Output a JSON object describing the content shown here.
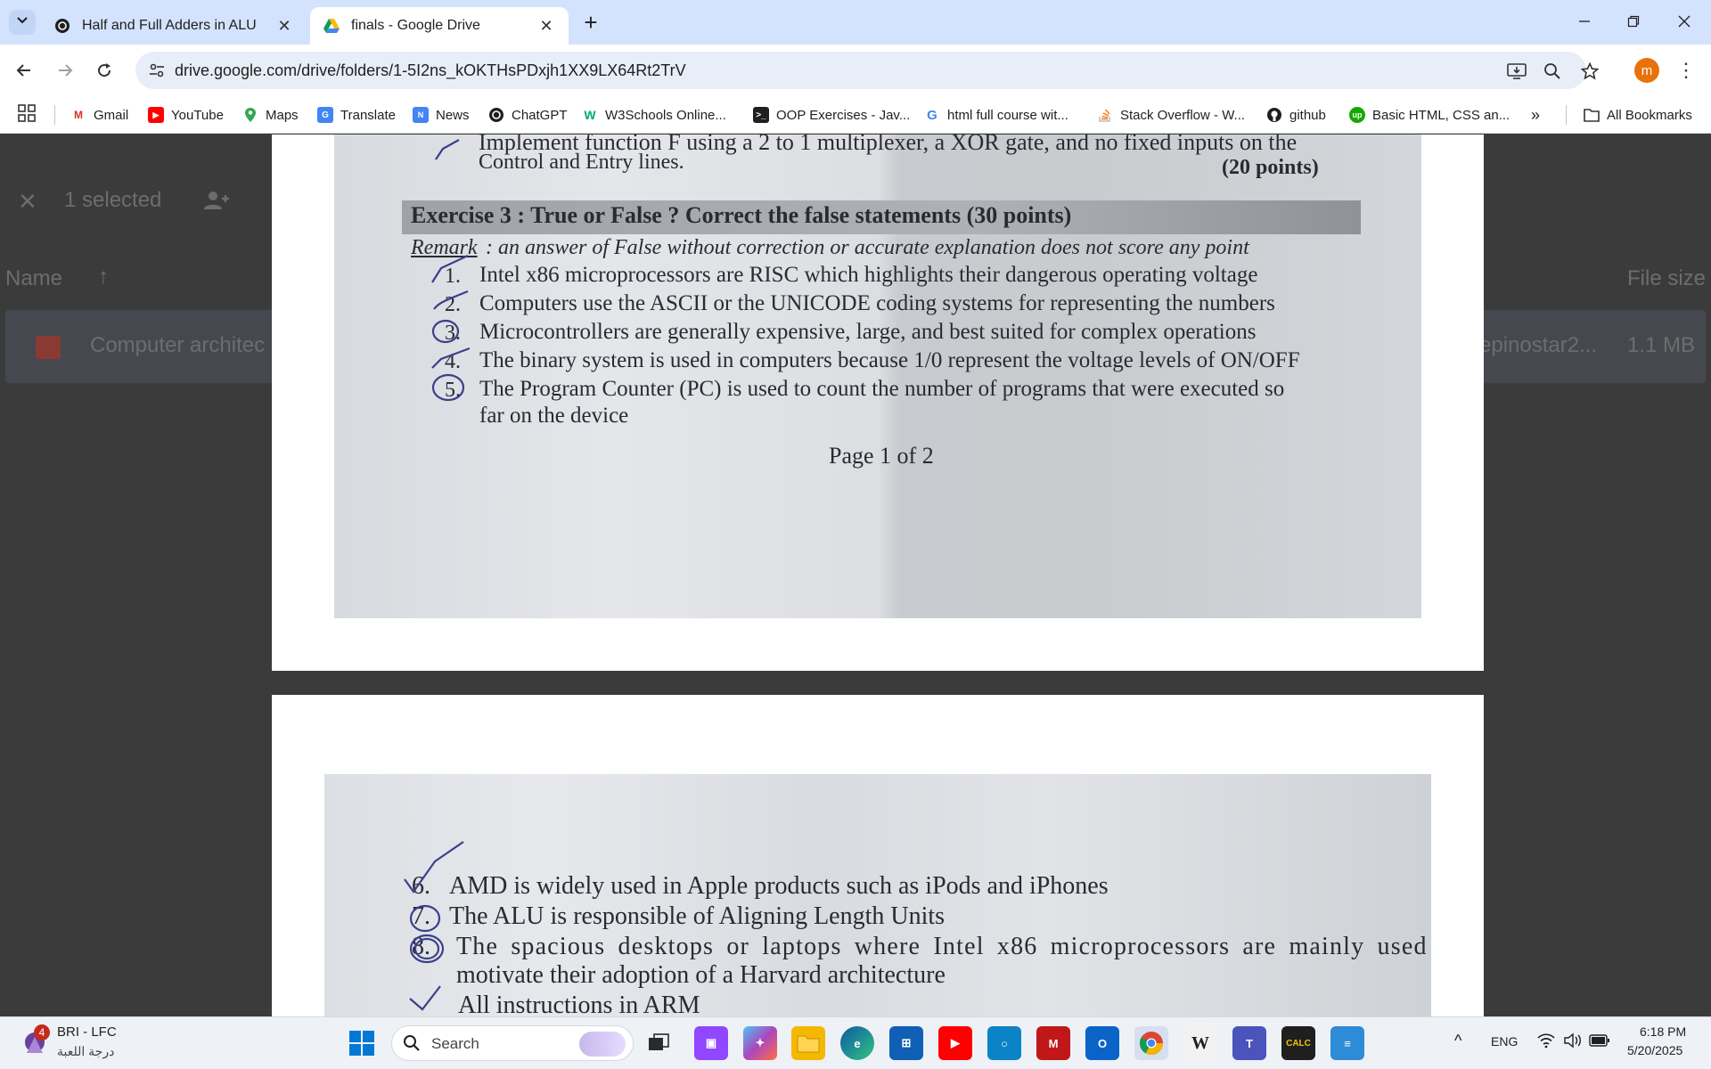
{
  "browser": {
    "tabs": [
      {
        "title": "Half and Full Adders in ALU",
        "active": false,
        "icon": "chatgpt-icon"
      },
      {
        "title": "finals - Google Drive",
        "active": true,
        "icon": "google-drive-icon"
      }
    ],
    "url": "drive.google.com/drive/folders/1-5I2ns_kOKTHsPDxjh1XX9LX64Rt2TrV",
    "profile_initial": "m",
    "bookmarks": [
      {
        "label": "Gmail",
        "icon": "gmail-icon"
      },
      {
        "label": "YouTube",
        "icon": "youtube-icon"
      },
      {
        "label": "Maps",
        "icon": "maps-icon"
      },
      {
        "label": "Translate",
        "icon": "translate-icon"
      },
      {
        "label": "News",
        "icon": "news-icon"
      },
      {
        "label": "ChatGPT",
        "icon": "chatgpt-icon"
      },
      {
        "label": "W3Schools Online...",
        "icon": "w3schools-icon"
      },
      {
        "label": "OOP Exercises - Jav...",
        "icon": "terminal-icon"
      },
      {
        "label": "html full course wit...",
        "icon": "google-icon"
      },
      {
        "label": "Stack Overflow - W...",
        "icon": "stackoverflow-icon"
      },
      {
        "label": "github",
        "icon": "github-icon"
      },
      {
        "label": "Basic HTML, CSS an...",
        "icon": "upwork-icon"
      }
    ],
    "all_bookmarks": "All Bookmarks"
  },
  "drive": {
    "selection_text": "1 selected",
    "column_name": "Name",
    "column_filesize": "File size",
    "file_name": "Computer architec",
    "file_owner": "epinostar2...",
    "file_size": "1.1 MB"
  },
  "pdf": {
    "page1": {
      "prev_line_1": "Implement function F using a 2 to 1 multiplexer, a XOR gate, and no fixed inputs on the",
      "prev_line_2": "Control and Entry lines.",
      "prev_points": "(20 points)",
      "exercise_header": "Exercise 3 : True or False ? Correct the false statements (30 points)",
      "remark_label": "Remark",
      "remark_text": ": an answer of False without correction or accurate explanation does not score any point",
      "items": [
        {
          "num": "1.",
          "text": "Intel x86 microprocessors are RISC which highlights their dangerous operating voltage"
        },
        {
          "num": "2.",
          "text": "Computers use the ASCII or the UNICODE coding systems for representing the numbers"
        },
        {
          "num": "3.",
          "text": "Microcontrollers are generally expensive, large, and best suited for complex operations"
        },
        {
          "num": "4.",
          "text": "The binary system is used in computers because 1/0 represent the voltage levels of ON/OFF"
        },
        {
          "num": "5.",
          "text": "The Program Counter (PC) is used to count the number of programs that were executed so"
        }
      ],
      "item5_cont": "far on the device",
      "page_footer": "Page 1 of 2"
    },
    "page2": {
      "items": [
        {
          "num": "6.",
          "text": "AMD is widely used in Apple products such as iPods and iPhones"
        },
        {
          "num": "7.",
          "text": "The ALU is responsible of Aligning Length Units"
        },
        {
          "num": "8.",
          "text": "The spacious desktops or laptops where Intel x86 microprocessors are mainly used"
        }
      ],
      "item8_cont": "motivate their adoption of a Harvard architecture",
      "item9_partial": "All instructions in ARM"
    }
  },
  "taskbar": {
    "widget_title": "BRI - LFC",
    "widget_subtitle": "درجة اللعبة",
    "widget_badge": "4",
    "search_placeholder": "Search",
    "language": "ENG",
    "time": "6:18 PM",
    "date": "5/20/2025"
  }
}
